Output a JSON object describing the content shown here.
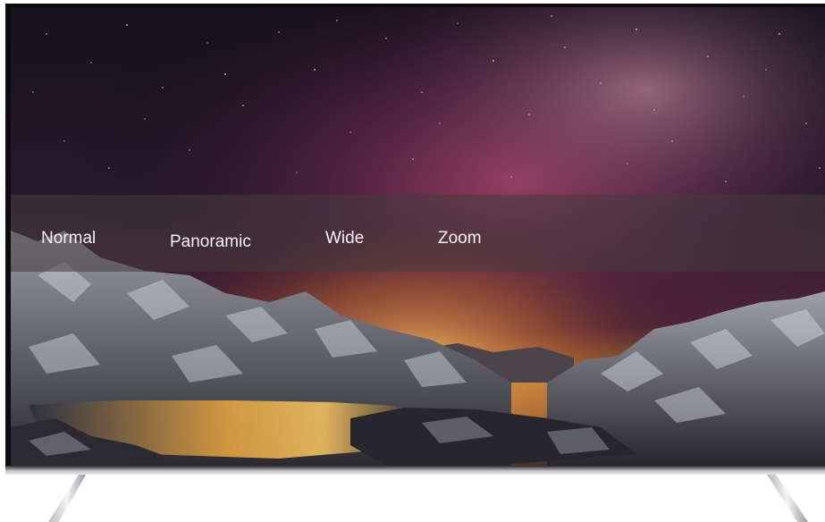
{
  "menu": {
    "items": [
      {
        "label": "Normal"
      },
      {
        "label": "Panoramic"
      },
      {
        "label": "Wide"
      },
      {
        "label": "Zoom"
      }
    ]
  },
  "background": {
    "subject": "night sky with milky way over snowy mountains and lake",
    "colors": {
      "sky_top": "#1a1420",
      "sky_glow": "#7a2e5a",
      "horizon": "#e0a040",
      "mountain": "#8a8a92",
      "lake": "#d89030",
      "menu_overlay": "#463c3c"
    }
  }
}
